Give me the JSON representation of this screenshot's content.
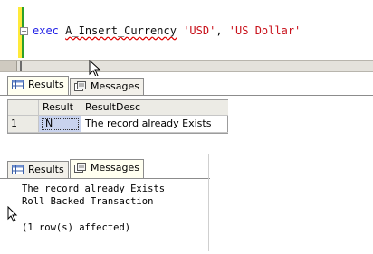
{
  "editor": {
    "collapse_glyph": "−",
    "keyword": "exec",
    "procedure": "A_Insert_Currency",
    "arg1": "'USD'",
    "separator": ",",
    "arg2": "'US Dollar'"
  },
  "top_panel": {
    "tabs": [
      {
        "label": "Results",
        "icon": "results-grid-icon",
        "active": true
      },
      {
        "label": "Messages",
        "icon": "messages-icon",
        "active": false
      }
    ],
    "grid": {
      "columns": [
        "Result",
        "ResultDesc"
      ],
      "rows": [
        {
          "row_number": "1",
          "cells": [
            "N",
            "The record already Exists"
          ]
        }
      ]
    }
  },
  "bottom_panel": {
    "tabs": [
      {
        "label": "Results",
        "icon": "results-grid-icon",
        "active": false
      },
      {
        "label": "Messages",
        "icon": "messages-icon",
        "active": true
      }
    ],
    "messages": [
      "The record already Exists",
      "Roll Backed Transaction",
      "",
      "(1 row(s) affected)"
    ]
  },
  "colors": {
    "keyword": "#1e1ee6",
    "string": "#c8101a",
    "gutter": "#ffea3a",
    "selected_cell": "#c9d3ee"
  }
}
